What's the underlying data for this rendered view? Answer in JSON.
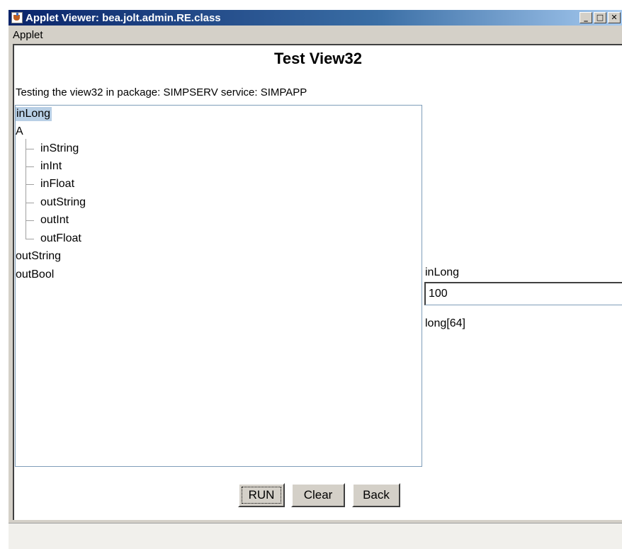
{
  "window": {
    "title": "Applet Viewer: bea.jolt.admin.RE.class",
    "buttons": {
      "minimize": "_",
      "maximize": "□",
      "close": "✕"
    }
  },
  "menubar": {
    "items": [
      {
        "label": "Applet"
      }
    ]
  },
  "applet": {
    "heading": "Test View32",
    "description": "Testing the view32 in package: SIMPSERV service: SIMPAPP",
    "tree": {
      "selected": "inLong",
      "nodes": [
        {
          "label": "inLong"
        },
        {
          "label": "A",
          "children": [
            {
              "label": "inString"
            },
            {
              "label": "inInt"
            },
            {
              "label": "inFloat"
            },
            {
              "label": "outString"
            },
            {
              "label": "outInt"
            },
            {
              "label": "outFloat"
            }
          ]
        },
        {
          "label": "outString"
        },
        {
          "label": "outBool"
        }
      ]
    },
    "field": {
      "label": "inLong",
      "value": "100",
      "type": "long[64]"
    },
    "buttons": {
      "run": "RUN",
      "clear": "Clear",
      "back": "Back"
    }
  }
}
